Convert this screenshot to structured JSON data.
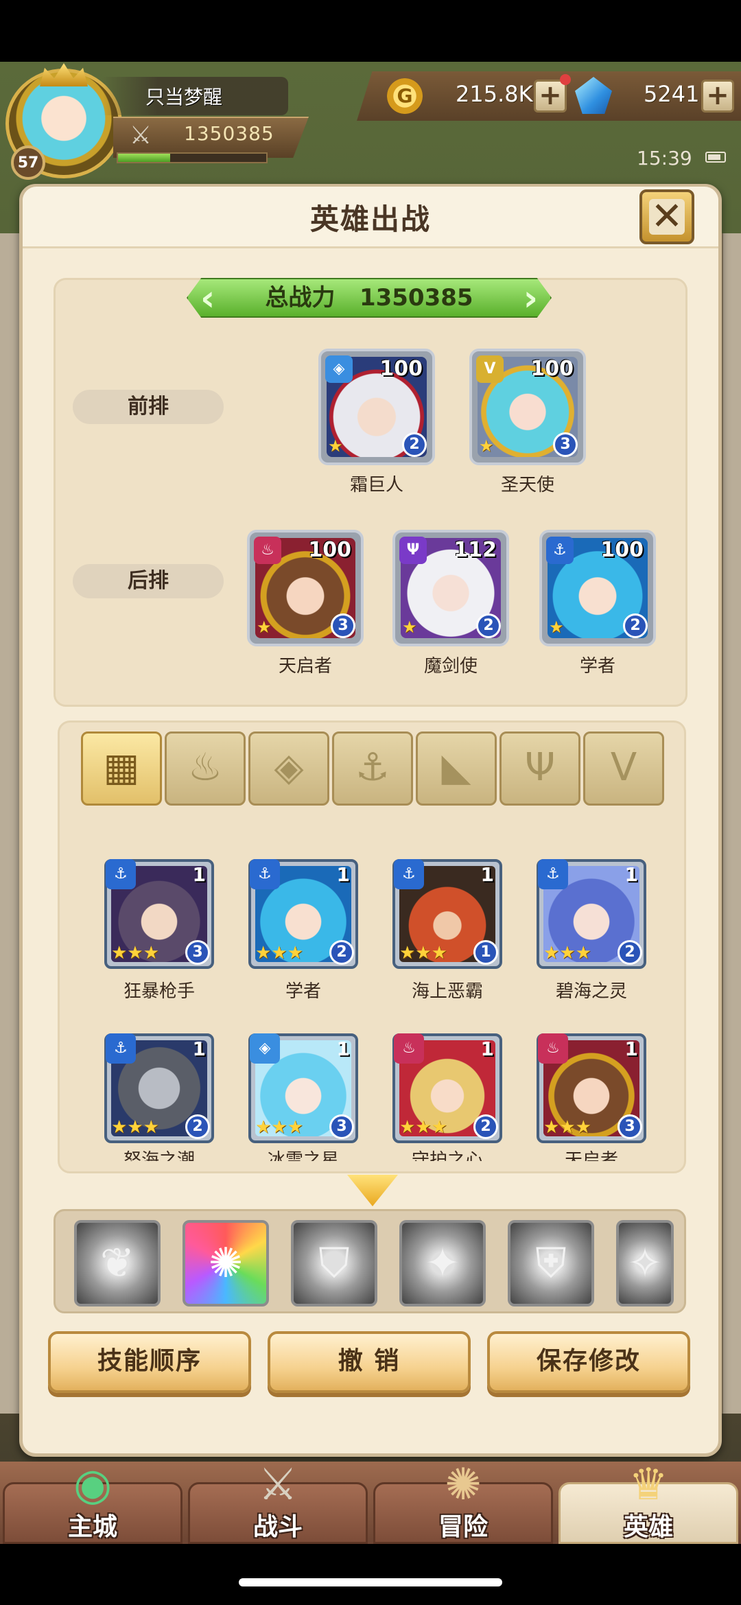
{
  "player": {
    "name": "只当梦醒",
    "level": "57",
    "power": "1350385",
    "xp_fraction": 0.35
  },
  "resources": {
    "gold": "215.8K",
    "gems": "5241",
    "coin_symbol": "G"
  },
  "status": {
    "time": "15:39"
  },
  "dialog": {
    "title": "英雄出战",
    "close_symbol": "✕"
  },
  "formation": {
    "total_label": "总战力",
    "total_value": "1350385",
    "front_label": "前排",
    "back_label": "后排",
    "front": [
      {
        "name": "霜巨人",
        "level": "100",
        "count": "2"
      },
      {
        "name": "圣天使",
        "level": "100",
        "count": "3"
      }
    ],
    "back": [
      {
        "name": "天启者",
        "level": "100",
        "count": "3"
      },
      {
        "name": "魔剑使",
        "level": "112",
        "count": "2"
      },
      {
        "name": "学者",
        "level": "100",
        "count": "2"
      }
    ]
  },
  "filters": [
    "all",
    "flame",
    "diamond",
    "anchor",
    "beast",
    "demon",
    "angel"
  ],
  "hero_list": {
    "row1": [
      {
        "name": "狂暴枪手",
        "level": "1",
        "count": "3"
      },
      {
        "name": "学者",
        "level": "1",
        "count": "2"
      },
      {
        "name": "海上恶霸",
        "level": "1",
        "count": "1"
      },
      {
        "name": "碧海之灵",
        "level": "1",
        "count": "2"
      }
    ],
    "row2": [
      {
        "name": "怒海之潮",
        "level": "1",
        "count": "2"
      },
      {
        "name": "冰雪之星",
        "level": "1",
        "count": "3"
      },
      {
        "name": "守护之心",
        "level": "1",
        "count": "2"
      },
      {
        "name": "天启者",
        "level": "1",
        "count": "3"
      }
    ]
  },
  "actions": {
    "skill_order": "技能顺序",
    "undo": "撤 销",
    "save": "保存修改"
  },
  "nav": [
    {
      "label": "主城",
      "icon": "castle-icon"
    },
    {
      "label": "战斗",
      "icon": "swords-icon"
    },
    {
      "label": "冒险",
      "icon": "map-icon"
    },
    {
      "label": "英雄",
      "icon": "hero-icon"
    }
  ]
}
